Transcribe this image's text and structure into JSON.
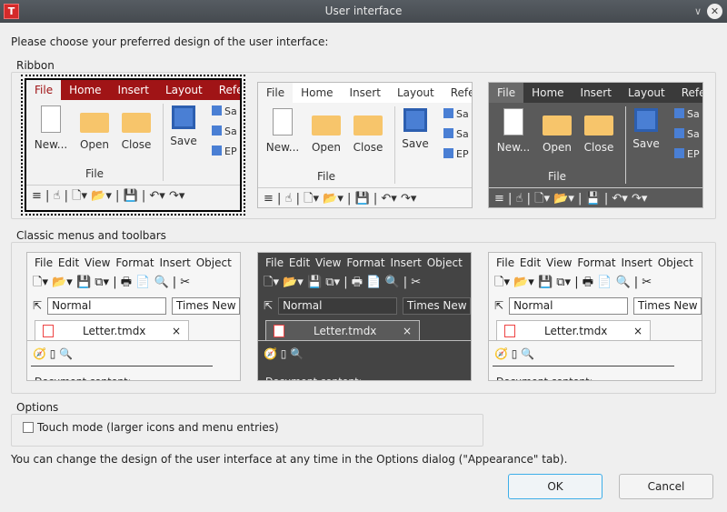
{
  "window": {
    "title": "User interface",
    "app_icon": "T"
  },
  "intro": "Please choose your preferred design of the user interface:",
  "ribbon_group": {
    "label": "Ribbon"
  },
  "classic_group": {
    "label": "Classic menus and toolbars"
  },
  "ribbon": {
    "tabs": [
      "File",
      "Home",
      "Insert",
      "Layout",
      "Refer"
    ],
    "buttons": [
      "New...",
      "Open",
      "Close",
      "Save"
    ],
    "small": [
      "Sa",
      "Sa",
      "EP"
    ],
    "group": "File"
  },
  "classic": {
    "menu": [
      "File",
      "Edit",
      "View",
      "Format",
      "Insert",
      "Object"
    ],
    "style": "Normal",
    "font": "Times New",
    "doc_tab": "Letter.tmdx",
    "doc_close": "×",
    "doc_content": "Document content:"
  },
  "ribbon_themes": [
    {
      "name": "red",
      "selected": true,
      "tab_color": "#a01416"
    },
    {
      "name": "light",
      "selected": false
    },
    {
      "name": "dark",
      "selected": false
    }
  ],
  "options": {
    "label": "Options",
    "touch_mode": "Touch mode (larger icons and menu entries)",
    "touch_mode_checked": false
  },
  "footer": "You can change the design of the user interface at any time in the Options dialog (\"Appearance\" tab).",
  "buttons": {
    "ok": "OK",
    "cancel": "Cancel"
  }
}
